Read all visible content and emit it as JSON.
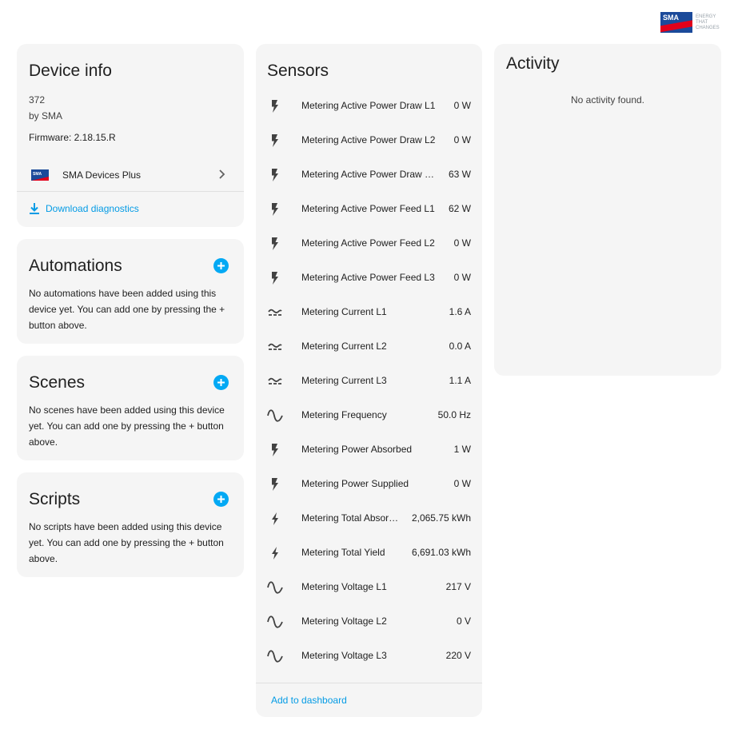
{
  "brand": {
    "logo_text": "SMA",
    "tagline": [
      "ENERGY",
      "THAT",
      "CHANGES"
    ],
    "colors": {
      "blue": "#1b4a9a",
      "red": "#e2001a",
      "accent": "#03a9f4"
    }
  },
  "device_info": {
    "title": "Device info",
    "model": "372",
    "manufacturer": "by SMA",
    "firmware": "Firmware: 2.18.15.R",
    "integration_label": "SMA Devices Plus",
    "download_label": "Download diagnostics"
  },
  "automations": {
    "title": "Automations",
    "text": "No automations have been added using this device yet. You can add one by pressing the + button above."
  },
  "scenes": {
    "title": "Scenes",
    "text": "No scenes have been added using this device yet. You can add one by pressing the + button above."
  },
  "scripts": {
    "title": "Scripts",
    "text": "No scripts have been added using this device yet. You can add one by pressing the + button above."
  },
  "sensors": {
    "title": "Sensors",
    "items": [
      {
        "icon": "flash-icon",
        "name": "Metering Active Power Draw L1",
        "value": "0 W"
      },
      {
        "icon": "flash-icon",
        "name": "Metering Active Power Draw L2",
        "value": "0 W"
      },
      {
        "icon": "flash-icon",
        "name": "Metering Active Power Draw …",
        "value": "63 W"
      },
      {
        "icon": "flash-icon",
        "name": "Metering Active Power Feed L1",
        "value": "62 W"
      },
      {
        "icon": "flash-icon",
        "name": "Metering Active Power Feed L2",
        "value": "0 W"
      },
      {
        "icon": "flash-icon",
        "name": "Metering Active Power Feed L3",
        "value": "0 W"
      },
      {
        "icon": "current-ac-icon",
        "name": "Metering Current L1",
        "value": "1.6 A"
      },
      {
        "icon": "current-ac-icon",
        "name": "Metering Current L2",
        "value": "0.0 A"
      },
      {
        "icon": "current-ac-icon",
        "name": "Metering Current L3",
        "value": "1.1 A"
      },
      {
        "icon": "sine-wave-icon",
        "name": "Metering Frequency",
        "value": "50.0 Hz"
      },
      {
        "icon": "flash-icon",
        "name": "Metering Power Absorbed",
        "value": "1 W"
      },
      {
        "icon": "flash-icon",
        "name": "Metering Power Supplied",
        "value": "0 W"
      },
      {
        "icon": "lightning-bolt-icon",
        "name": "Metering Total Absor…",
        "value": "2,065.75 kWh"
      },
      {
        "icon": "lightning-bolt-icon",
        "name": "Metering Total Yield",
        "value": "6,691.03 kWh"
      },
      {
        "icon": "sine-wave-icon",
        "name": "Metering Voltage L1",
        "value": "217 V"
      },
      {
        "icon": "sine-wave-icon",
        "name": "Metering Voltage L2",
        "value": "0 V"
      },
      {
        "icon": "sine-wave-icon",
        "name": "Metering Voltage L3",
        "value": "220 V"
      }
    ],
    "add_to_dashboard": "Add to dashboard"
  },
  "activity": {
    "title": "Activity",
    "empty_text": "No activity found."
  }
}
